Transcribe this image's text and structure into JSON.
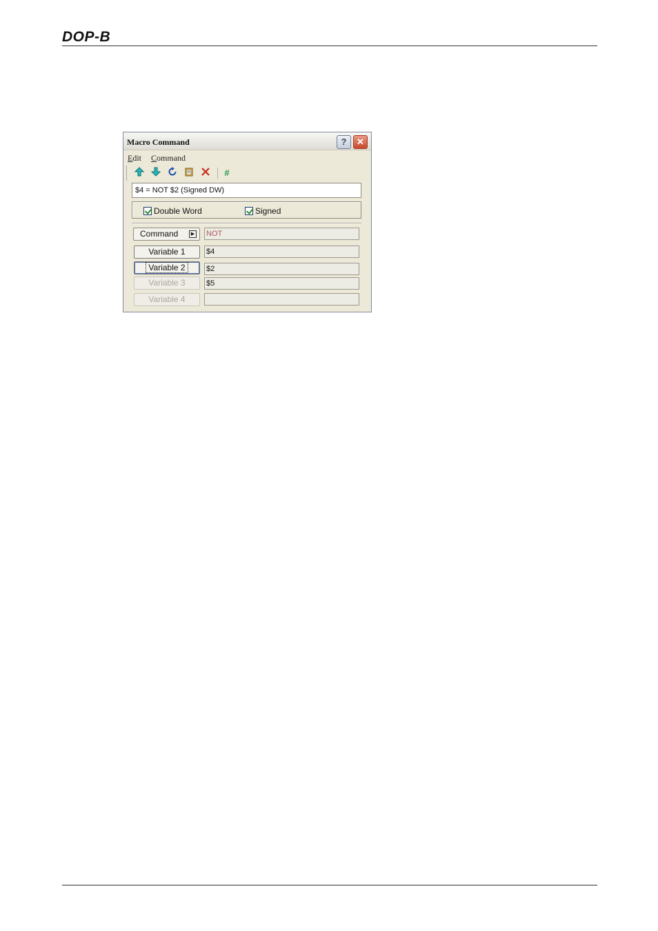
{
  "page_header": {
    "logo": "DOP-B"
  },
  "dialog": {
    "title": "Macro Command",
    "help_button": "?",
    "close_button": "✕",
    "menu": [
      {
        "label": "Edit",
        "accel": "E",
        "rest": "dit"
      },
      {
        "label": "Command",
        "accel": "C",
        "rest": "ommand"
      }
    ],
    "toolbar_icons": [
      "arrow-up-icon",
      "arrow-down-icon",
      "refresh-icon",
      "paste-icon",
      "delete-icon",
      "hash-icon"
    ],
    "expression": "$4 = NOT $2 (Signed DW)",
    "options": {
      "double_word": {
        "label": "Double Word",
        "checked": true
      },
      "signed": {
        "label": "Signed",
        "checked": true
      }
    },
    "command": {
      "label": "Command",
      "value": "NOT"
    },
    "variables": [
      {
        "label": "Variable 1",
        "value": "$4",
        "enabled": true
      },
      {
        "label": "Variable 2",
        "value": "$2",
        "enabled": true
      },
      {
        "label": "Variable 3",
        "value": "$5",
        "enabled": false
      },
      {
        "label": "Variable 4",
        "value": "",
        "enabled": false
      }
    ]
  },
  "colors": {
    "dialog_bg": "#ece9d8",
    "command_value": "#b0585c",
    "close_button": "#c9452b"
  }
}
